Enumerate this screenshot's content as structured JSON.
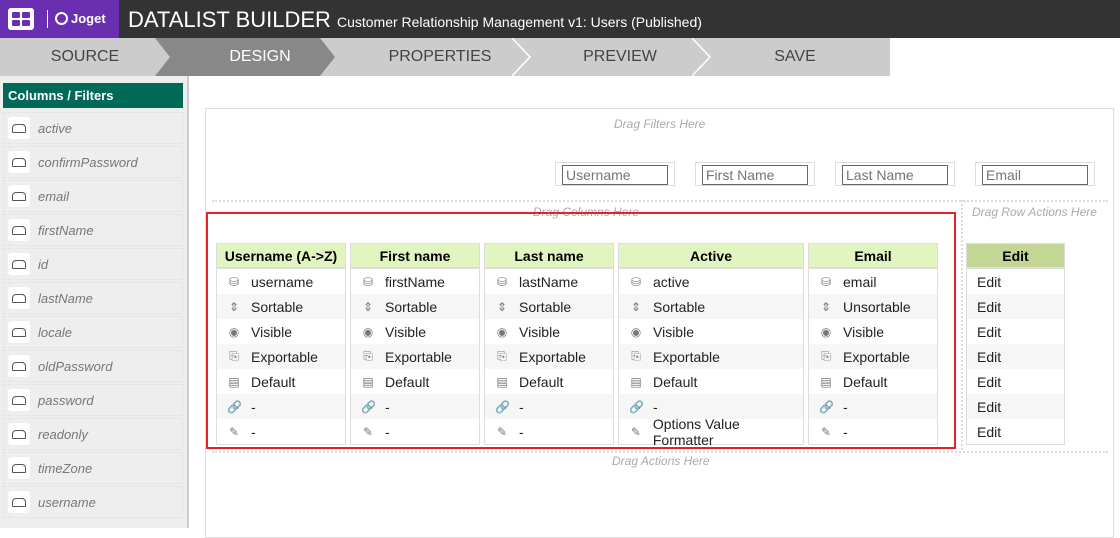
{
  "header": {
    "logo_text": "Joget",
    "title": "DATALIST BUILDER",
    "subtitle": "Customer Relationship Management v1: Users (Published)"
  },
  "tabs": [
    {
      "label": "SOURCE"
    },
    {
      "label": "DESIGN",
      "active": true
    },
    {
      "label": "PROPERTIES"
    },
    {
      "label": "PREVIEW"
    },
    {
      "label": "SAVE"
    }
  ],
  "sidebar": {
    "title": "Columns / Filters",
    "items": [
      "active",
      "confirmPassword",
      "email",
      "firstName",
      "id",
      "lastName",
      "locale",
      "oldPassword",
      "password",
      "readonly",
      "timeZone",
      "username"
    ]
  },
  "canvas": {
    "drag_filters": "Drag Filters Here",
    "drag_columns": "Drag Columns Here",
    "drag_row_actions": "Drag Row Actions Here",
    "drag_actions": "Drag Actions Here",
    "filters": [
      "Username",
      "First Name",
      "Last Name",
      "Email"
    ],
    "columns": [
      {
        "title": "Username (A->Z)",
        "rows": [
          "username",
          "Sortable",
          "Visible",
          "Exportable",
          "Default",
          "-",
          "-"
        ]
      },
      {
        "title": "First name",
        "rows": [
          "firstName",
          "Sortable",
          "Visible",
          "Exportable",
          "Default",
          "-",
          "-"
        ]
      },
      {
        "title": "Last name",
        "rows": [
          "lastName",
          "Sortable",
          "Visible",
          "Exportable",
          "Default",
          "-",
          "-"
        ]
      },
      {
        "title": "Active",
        "rows": [
          "active",
          "Sortable",
          "Visible",
          "Exportable",
          "Default",
          "-",
          "Options Value Formatter"
        ]
      },
      {
        "title": "Email",
        "rows": [
          "email",
          "Unsortable",
          "Visible",
          "Exportable",
          "Default",
          "-",
          "-"
        ]
      }
    ],
    "row_action": {
      "title": "Edit",
      "rows": [
        "Edit",
        "Edit",
        "Edit",
        "Edit",
        "Edit",
        "Edit",
        "Edit"
      ]
    }
  },
  "icons": [
    "database-icon",
    "sort-icon",
    "eye-icon",
    "export-icon",
    "ruler-icon",
    "link-icon",
    "brush-icon"
  ],
  "colors": {
    "header": "#333333",
    "logo": "#6a2fb0",
    "sidebar_head": "#006a57",
    "col_head": "#e2f5c1",
    "action_head": "#c4d696",
    "highlight": "#e8202a"
  }
}
